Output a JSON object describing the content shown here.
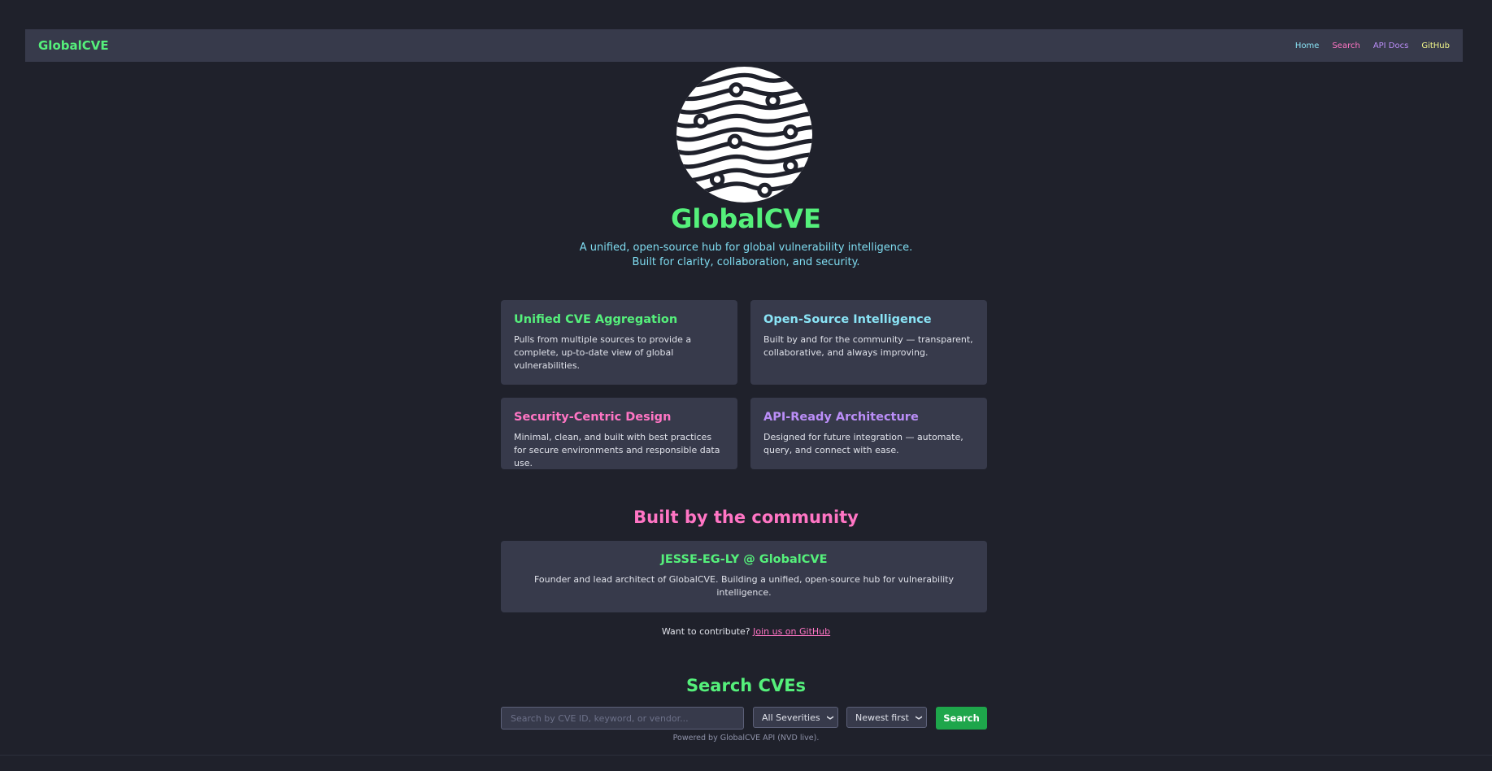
{
  "navbar": {
    "brand": "GlobalCVE",
    "links": [
      "Home",
      "Search",
      "API Docs",
      "GitHub"
    ]
  },
  "hero": {
    "logo": "globe-circuit-logo",
    "title": "GlobalCVE",
    "tagline_line1": "A unified, open-source hub for global vulnerability intelligence.",
    "tagline_line2": "Built for clarity, collaboration, and security."
  },
  "features": [
    {
      "title": "Unified CVE Aggregation",
      "text": "Pulls from multiple sources to provide a complete, up-to-date view of global vulnerabilities.",
      "color": "#55f07b"
    },
    {
      "title": "Open-Source Intelligence",
      "text": "Built by and for the community — transparent, collaborative, and always improving.",
      "color": "#8ae4f6"
    },
    {
      "title": "Security-Centric Design",
      "text": "Minimal, clean, and built with best practices for secure environments and responsible data use.",
      "color": "#ff75c4"
    },
    {
      "title": "API-Ready Architecture",
      "text": "Designed for future integration — automate, query, and connect with ease.",
      "color": "#bb8ef8"
    }
  ],
  "community": {
    "heading": "Built by the community",
    "founder_name": "JESSE-EG-LY @ GlobalCVE",
    "founder_text": "Founder and lead architect of GlobalCVE. Building a unified, open-source hub for vulnerability intelligence.",
    "contribute_text": "Want to contribute? ",
    "contribute_link": "Join us on GitHub"
  },
  "search": {
    "heading": "Search CVEs",
    "placeholder": "Search by CVE ID, keyword, or vendor...",
    "value": "",
    "severity_selected": "All Severities",
    "sort_selected": "Newest first",
    "button_label": "Search",
    "powered_by": "Powered by GlobalCVE API (NVD live)."
  },
  "colors": {
    "background": "#1f212b",
    "panel": "#373a4b",
    "accent_green": "#55f07b",
    "accent_cyan": "#8ae4f6",
    "accent_pink": "#ff75c4",
    "accent_purple": "#bb8ef8",
    "accent_yellow": "#f2f68a",
    "button_green": "#1ea64b"
  }
}
